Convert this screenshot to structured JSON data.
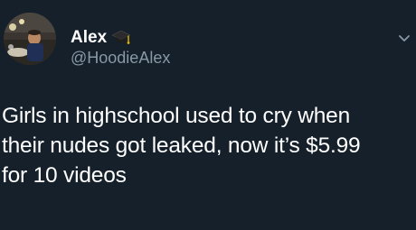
{
  "tweet": {
    "author": {
      "display_name": "Alex",
      "handle": "@HoodieAlex",
      "name_badge_icon": "graduation-cap-icon"
    },
    "text_lines": [
      "Girls in highschool used to cry when",
      "their nudes got leaked, now it’s $5.99",
      "for 10 videos"
    ]
  },
  "colors": {
    "background": "#15202b",
    "text_primary": "#ffffff",
    "text_secondary": "#8899a6"
  }
}
